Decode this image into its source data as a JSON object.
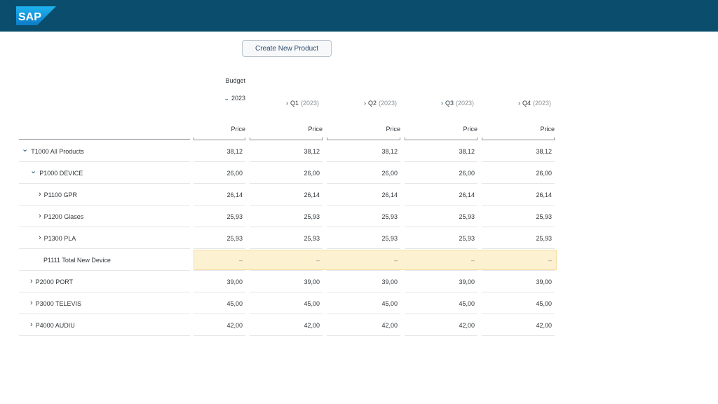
{
  "app": {
    "logo_text": "SAP",
    "accent_color": "#0a4d6c",
    "highlight_color": "#fcf1d0"
  },
  "toolbar": {
    "create_label": "Create New Product"
  },
  "header": {
    "budget_label": "Budget",
    "year_label": "2023",
    "year_icon": "chevron-down-icon",
    "quarters": [
      {
        "label": "Q1",
        "sub": "(2023)",
        "icon": "chevron-right-icon"
      },
      {
        "label": "Q2",
        "sub": "(2023)",
        "icon": "chevron-right-icon"
      },
      {
        "label": "Q3",
        "sub": "(2023)",
        "icon": "chevron-right-icon"
      },
      {
        "label": "Q4",
        "sub": "(2023)",
        "icon": "chevron-right-icon"
      }
    ],
    "measure_label": "Price"
  },
  "rows": [
    {
      "label": "T1000 All Products",
      "expander": "chevron-down-icon",
      "values": [
        "38,12",
        "38,12",
        "38,12",
        "38,12",
        "38,12"
      ]
    },
    {
      "label": "P1000 DEVICE",
      "expander": "chevron-down-icon",
      "values": [
        "26,00",
        "26,00",
        "26,00",
        "26,00",
        "26,00"
      ]
    },
    {
      "label": "P1100 GPR",
      "expander": "chevron-right-icon",
      "values": [
        "26,14",
        "26,14",
        "26,14",
        "26,14",
        "26,14"
      ]
    },
    {
      "label": "P1200 Glases",
      "expander": "chevron-right-icon",
      "values": [
        "25,93",
        "25,93",
        "25,93",
        "25,93",
        "25,93"
      ]
    },
    {
      "label": "P1300 PLA",
      "expander": "chevron-right-icon",
      "values": [
        "25,93",
        "25,93",
        "25,93",
        "25,93",
        "25,93"
      ]
    },
    {
      "label": "P1111 Total New Device",
      "expander": "",
      "highlighted": true,
      "values": [
        "–",
        "–",
        "–",
        "–",
        "–"
      ]
    },
    {
      "label": "P2000 PORT",
      "expander": "chevron-right-icon",
      "values": [
        "39,00",
        "39,00",
        "39,00",
        "39,00",
        "39,00"
      ]
    },
    {
      "label": "P3000 TELEVIS",
      "expander": "chevron-right-icon",
      "values": [
        "45,00",
        "45,00",
        "45,00",
        "45,00",
        "45,00"
      ]
    },
    {
      "label": "P4000 AUDIU",
      "expander": "chevron-right-icon",
      "values": [
        "42,00",
        "42,00",
        "42,00",
        "42,00",
        "42,00"
      ]
    }
  ]
}
